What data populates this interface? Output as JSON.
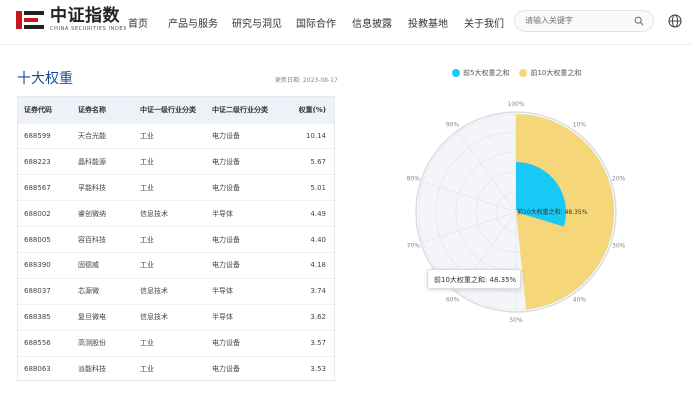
{
  "header": {
    "logo_cn": "中证指数",
    "logo_en": "CHINA SECURITIES INDEX",
    "nav": [
      "首页",
      "产品与服务",
      "研究与洞见",
      "国际合作",
      "信息披露",
      "投教基地",
      "关于我们"
    ],
    "search_placeholder": "请输入关键字"
  },
  "main": {
    "title": "十大权重",
    "date": "更新日期: 2023-08-17",
    "columns": [
      "证券代码",
      "证券名称",
      "中证一级行业分类",
      "中证二级行业分类",
      "权重(%)"
    ],
    "rows": [
      [
        "688599",
        "天合光能",
        "工业",
        "电力设备",
        "10.14"
      ],
      [
        "688223",
        "晶科能源",
        "工业",
        "电力设备",
        "5.67"
      ],
      [
        "688567",
        "孚能科技",
        "工业",
        "电力设备",
        "5.01"
      ],
      [
        "688002",
        "睿创微纳",
        "信息技术",
        "半导体",
        "4.49"
      ],
      [
        "688005",
        "容百科技",
        "工业",
        "电力设备",
        "4.40"
      ],
      [
        "688390",
        "固德威",
        "工业",
        "电力设备",
        "4.18"
      ],
      [
        "688037",
        "芯源微",
        "信息技术",
        "半导体",
        "3.74"
      ],
      [
        "688385",
        "复旦微电",
        "信息技术",
        "半导体",
        "3.62"
      ],
      [
        "688556",
        "高测股份",
        "工业",
        "电力设备",
        "3.57"
      ],
      [
        "688063",
        "派能科技",
        "工业",
        "电力设备",
        "3.53"
      ]
    ]
  },
  "chart_data": {
    "type": "pie",
    "subtype": "polar-bar",
    "series": [
      {
        "name": "前5大权重之和",
        "value": 29.71,
        "color": "#18c9f5"
      },
      {
        "name": "前10大权重之和",
        "value": 48.35,
        "color": "#f5d77a"
      }
    ],
    "angle_ticks": [
      "100%",
      "10%",
      "20%",
      "30%",
      "40%",
      "50%",
      "60%",
      "70%",
      "80%",
      "90%"
    ],
    "inner_label": "前10大权重之和: 48.35%",
    "tooltip": "前10大权重之和: 48.35%",
    "legend_position": "top"
  }
}
